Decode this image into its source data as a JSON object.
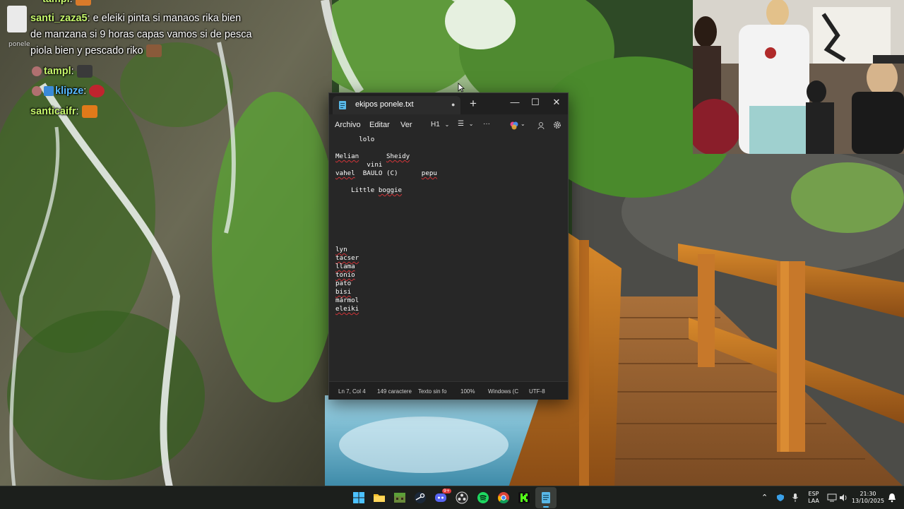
{
  "chat": {
    "header_partial": "tampl",
    "side_tag": "ponele",
    "messages": [
      {
        "user": "santi_zaza5",
        "text": "e eleiki pinta si manaos rika bien"
      },
      {
        "user": "",
        "text": "de manzana si 9 horas capas vamos si de pesca"
      },
      {
        "user": "",
        "text": "piola bien y pescado riko"
      },
      {
        "user": "tampl",
        "text": ""
      },
      {
        "user": "klipze",
        "text": ""
      },
      {
        "user": "santicaifr",
        "text": ""
      }
    ]
  },
  "notepad": {
    "tab_title": "ekipos ponele.txt",
    "tab_modified_icon": "dot-icon",
    "window_controls": {
      "minimize": "—",
      "maximize": "☐",
      "close": "✕"
    },
    "menu": {
      "file": "Archivo",
      "edit": "Editar",
      "view": "Ver"
    },
    "toolbar": {
      "heading": "H1",
      "list": "☰",
      "more": "···"
    },
    "lines": [
      "      lolo",
      "",
      "Melian       Sheidy",
      "        vini",
      "vahel  BAULO (C)      pepu",
      "",
      "    Little boggie",
      "",
      "",
      "",
      "",
      "",
      "",
      "lyn",
      "tacser",
      "llama",
      "tonio",
      "pato",
      "bisi",
      "mármol",
      "eleiki"
    ],
    "status": {
      "position": "Ln 7, Col 4",
      "chars": "149 caractere",
      "format": "Texto sin fo",
      "zoom": "100%",
      "line_ending": "Windows (C",
      "encoding": "UTF-8"
    }
  },
  "taskbar": {
    "lang_top": "ESP",
    "lang_bottom": "LAA",
    "time": "21:30",
    "date": "13/10/2025",
    "discord_badge": "9+"
  },
  "colors": {
    "notepad_bg": "#272727",
    "title_bg": "#202020",
    "chat_username": "#c6f76c",
    "spell_error": "#d13438"
  }
}
